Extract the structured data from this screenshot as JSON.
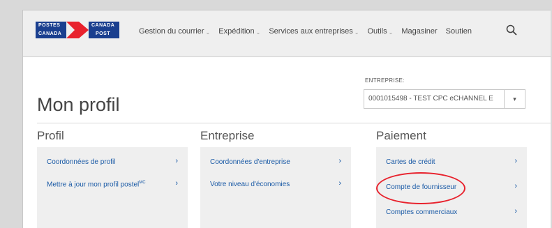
{
  "logo": {
    "top_left": "POSTES",
    "top_right": "CANADA",
    "bottom_left": "CANADA",
    "bottom_right": "POST",
    "brand_color": "#1a3f8f",
    "accent_color": "#e8222d"
  },
  "nav": {
    "items": [
      {
        "label": "Gestion du courrier",
        "has_menu": true
      },
      {
        "label": "Expédition",
        "has_menu": true
      },
      {
        "label": "Services aux entreprises",
        "has_menu": true
      },
      {
        "label": "Outils",
        "has_menu": true
      },
      {
        "label": "Magasiner",
        "has_menu": false
      },
      {
        "label": "Soutien",
        "has_menu": false
      }
    ],
    "search_icon": "search-icon"
  },
  "page": {
    "title": "Mon profil"
  },
  "business": {
    "label": "ENTREPRISE:",
    "selected": "0001015498 - TEST CPC eCHANNEL E",
    "arrow": "▾"
  },
  "columns": [
    {
      "heading": "Profil",
      "links": [
        {
          "label": "Coordonnées de profil",
          "sup": ""
        },
        {
          "label": "Mettre à jour mon profil postel",
          "sup": "MC"
        }
      ]
    },
    {
      "heading": "Entreprise",
      "links": [
        {
          "label": "Coordonnées d'entreprise",
          "sup": ""
        },
        {
          "label": "Votre niveau d'économies",
          "sup": ""
        }
      ]
    },
    {
      "heading": "Paiement",
      "links": [
        {
          "label": "Cartes de crédit",
          "sup": ""
        },
        {
          "label": "Compte de fournisseur",
          "sup": ""
        },
        {
          "label": "Comptes commerciaux",
          "sup": ""
        }
      ]
    }
  ],
  "chevron": "›",
  "link_color": "#1a5aa6",
  "highlight_color": "#e8222d"
}
